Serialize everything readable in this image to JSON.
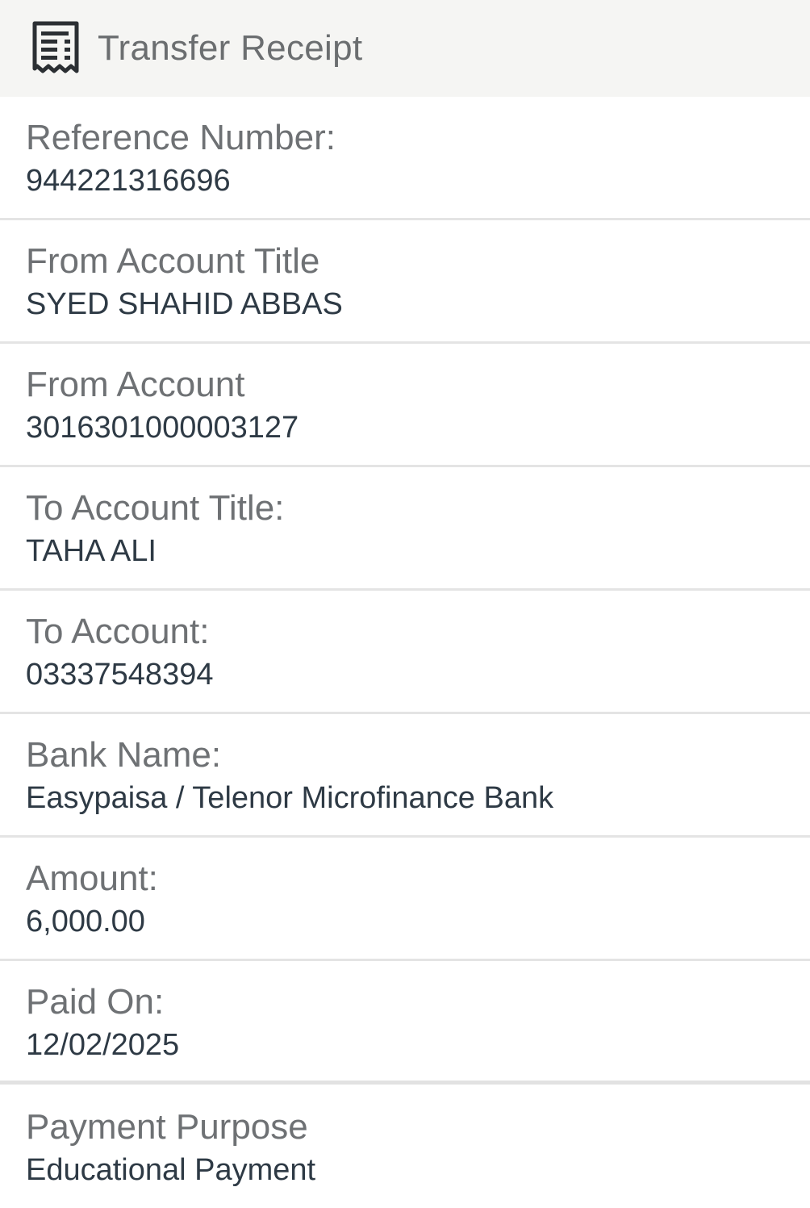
{
  "header": {
    "icon": "receipt-icon",
    "title": "Transfer Receipt"
  },
  "rows": [
    {
      "label": "Reference Number:",
      "value": "944221316696"
    },
    {
      "label": "From Account Title",
      "value": "SYED SHAHID ABBAS"
    },
    {
      "label": "From Account",
      "value": "3016301000003127"
    },
    {
      "label": "To Account Title:",
      "value": "TAHA ALI"
    },
    {
      "label": "To Account:",
      "value": "03337548394"
    },
    {
      "label": "Bank Name:",
      "value": "Easypaisa / Telenor Microfinance Bank"
    },
    {
      "label": "Amount:",
      "value": "6,000.00"
    },
    {
      "label": "Paid On:",
      "value": "12/02/2025"
    },
    {
      "label": "Payment Purpose",
      "value": "Educational Payment"
    }
  ],
  "colors": {
    "header_bg": "#f5f5f3",
    "label": "#6e7174",
    "value": "#2e3a45",
    "divider": "#e4e4e4",
    "icon": "#2b2f33"
  }
}
